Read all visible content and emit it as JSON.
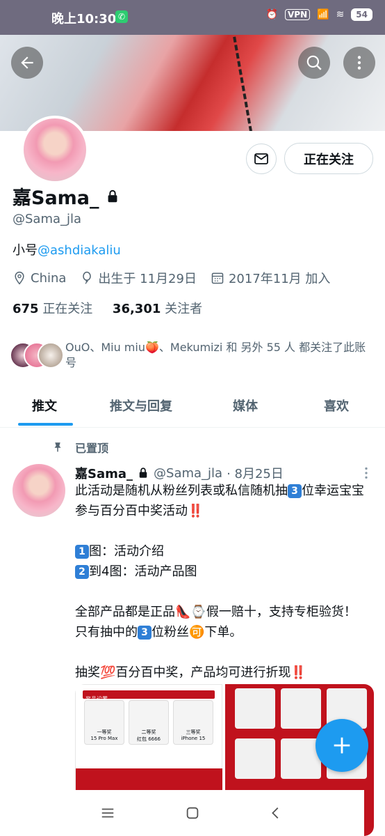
{
  "status_bar": {
    "time": "晚上10:30",
    "vpn": "VPN",
    "battery": "54"
  },
  "profile": {
    "name": "嘉Sama_",
    "handle": "@Sama_jla",
    "bio_prefix": "小号",
    "bio_link": "@ashdiakaliu",
    "location": "China",
    "birthday": "出生于 11月29日",
    "joined": "2017年11月 加入",
    "following_count": "675",
    "following_label": "正在关注",
    "followers_count": "36,301",
    "followers_label": "关注者",
    "follow_button": "正在关注",
    "followed_by": "OuO、Miu miu🍑、Mekumizi 和 另外 55 人 都关注了此账号"
  },
  "tabs": [
    {
      "label": "推文"
    },
    {
      "label": "推文与回复"
    },
    {
      "label": "媒体"
    },
    {
      "label": "喜欢"
    }
  ],
  "tweet": {
    "pinned_label": "已置顶",
    "author": "嘉Sama_",
    "handle": "@Sama_jla",
    "date": "· 8月25日",
    "line1a": "此活动是随机从粉丝列表或私信随机抽",
    "line1_num": "3",
    "line1b": "位幸运宝宝参与百分百中奖活动",
    "bang": "‼️",
    "line2_num": "1",
    "line2": "图：活动介绍",
    "line3_num": "2",
    "line3": "到4图：活动产品图",
    "line4a": "全部产品都是正品👠⌚假一赔十，支持专柜验货！只有抽中的",
    "line4_num": "3",
    "line4b": "位粉丝🉑下单。",
    "line5": "抽奖💯百分百中奖，产品均可进行折现",
    "media_img1_title": "奖品设置",
    "media_items": [
      "一等奖",
      "二等奖",
      "三等奖"
    ],
    "media_names": [
      "15 Pro Max",
      "红包 6666",
      "iPhone 15"
    ]
  },
  "colors": {
    "accent": "#1d9bf0",
    "status_bar": "#6f6b7f",
    "promo_red": "#c0121d"
  }
}
